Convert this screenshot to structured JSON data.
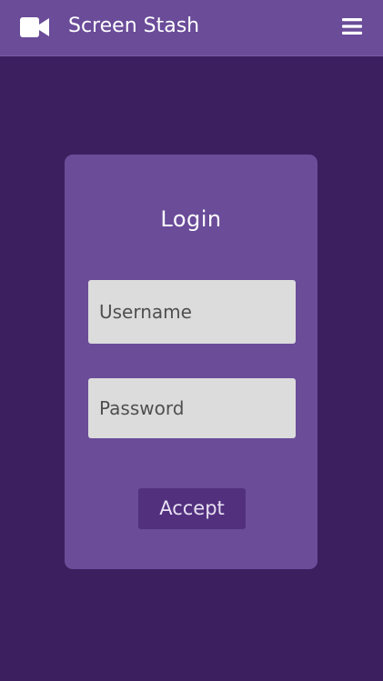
{
  "header": {
    "title": "Screen Stash",
    "logo_icon": "video-camera-icon",
    "menu_icon": "hamburger-menu-icon",
    "background_color": "#6a4c99"
  },
  "page": {
    "background_color": "#3c1f5e"
  },
  "login_card": {
    "title": "Login",
    "username_placeholder": "Username",
    "password_placeholder": "Password",
    "accept_label": "Accept",
    "card_color": "#6a4c99",
    "button_color": "#52307e",
    "field_color": "#dcdcdc"
  }
}
